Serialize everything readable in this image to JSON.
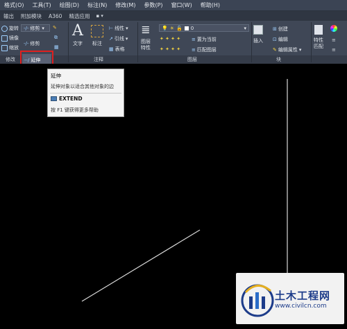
{
  "menubar": {
    "items": [
      "格式(O)",
      "工具(T)",
      "绘图(D)",
      "标注(N)",
      "修改(M)",
      "参数(P)",
      "窗口(W)",
      "帮助(H)"
    ]
  },
  "tabs": {
    "items": [
      "输出",
      "附加模块",
      "A360",
      "精选应用"
    ],
    "extra": "▪ ▾"
  },
  "modify_panel": {
    "rotate": "旋转",
    "mirror": "镜像",
    "scale": "缩放",
    "trim_dropdown": "修剪",
    "trim": "修剪",
    "extend": "延伸",
    "label": "修改"
  },
  "annotation_panel": {
    "text": "文字",
    "dimension": "标注",
    "linear": "线性",
    "leader": "引线",
    "table": "表格",
    "label": "注释"
  },
  "layers_panel": {
    "layer_props": "图层\n特性",
    "layer_value": "0",
    "set_current": "置为当前",
    "match_layer": "匹配图层",
    "label": "图层"
  },
  "block_panel": {
    "insert": "插入",
    "create": "创建",
    "edit": "编辑",
    "edit_attrib": "编辑属性",
    "label": "块"
  },
  "props_panel": {
    "match": "特性\n匹配"
  },
  "tooltip": {
    "title": "延伸",
    "description": "延伸对象以适合其他对象的边",
    "command": "EXTEND",
    "help": "按 F1 键获得更多帮助"
  },
  "watermark": {
    "title": "土木工程网",
    "url": "www.civilcn.com"
  },
  "colors": {
    "highlight": "#e02020",
    "ribbon": "#3f4756",
    "canvas": "#000000"
  }
}
